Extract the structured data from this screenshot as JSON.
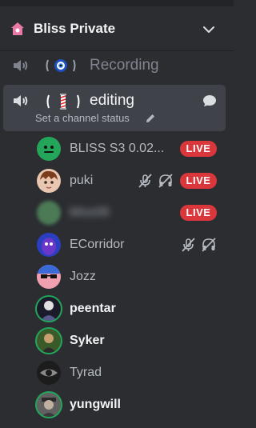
{
  "server": {
    "name": "Bliss Private",
    "icon": "home-icon",
    "accent": "#e97aa8"
  },
  "channels": [
    {
      "id": "recording",
      "label": "Recording",
      "emoji": "evil-eye"
    },
    {
      "id": "editing",
      "label": "editing",
      "emoji": "barber-pole",
      "status_placeholder": "Set a channel status"
    }
  ],
  "users": [
    {
      "name": "BLISS S3 0.02...",
      "live": true,
      "muted": false,
      "deafened": false,
      "speaking_ring": false,
      "avatar_color": "#23a55a"
    },
    {
      "name": "puki",
      "live": true,
      "muted": true,
      "deafened": true,
      "speaking_ring": false,
      "avatar_color": "#e8c6b0"
    },
    {
      "name": "bliss06",
      "live": true,
      "muted": false,
      "deafened": false,
      "speaking_ring": false,
      "blurred": true,
      "avatar_color": "#4b7a55"
    },
    {
      "name": "ECorridor",
      "live": false,
      "muted": true,
      "deafened": true,
      "speaking_ring": false,
      "avatar_color": "#6a37c9"
    },
    {
      "name": "Jozz",
      "live": false,
      "muted": false,
      "deafened": false,
      "speaking_ring": false,
      "avatar_color": "#f0a0b0"
    },
    {
      "name": "peentar",
      "live": false,
      "muted": false,
      "deafened": false,
      "speaking_ring": true,
      "bold": true,
      "avatar_color": "#1a1a2a"
    },
    {
      "name": "Syker",
      "live": false,
      "muted": false,
      "deafened": false,
      "speaking_ring": true,
      "bold": true,
      "avatar_color": "#3a5a2a"
    },
    {
      "name": "Tyrad",
      "live": false,
      "muted": false,
      "deafened": false,
      "speaking_ring": false,
      "avatar_color": "#1c1c1c"
    },
    {
      "name": "yungwill",
      "live": false,
      "muted": false,
      "deafened": false,
      "speaking_ring": true,
      "bold": true,
      "avatar_color": "#606060"
    }
  ],
  "labels": {
    "live": "LIVE"
  },
  "colors": {
    "live": "#da373c",
    "speaking": "#23a55a",
    "background": "#2b2d31",
    "selected": "#404249"
  }
}
